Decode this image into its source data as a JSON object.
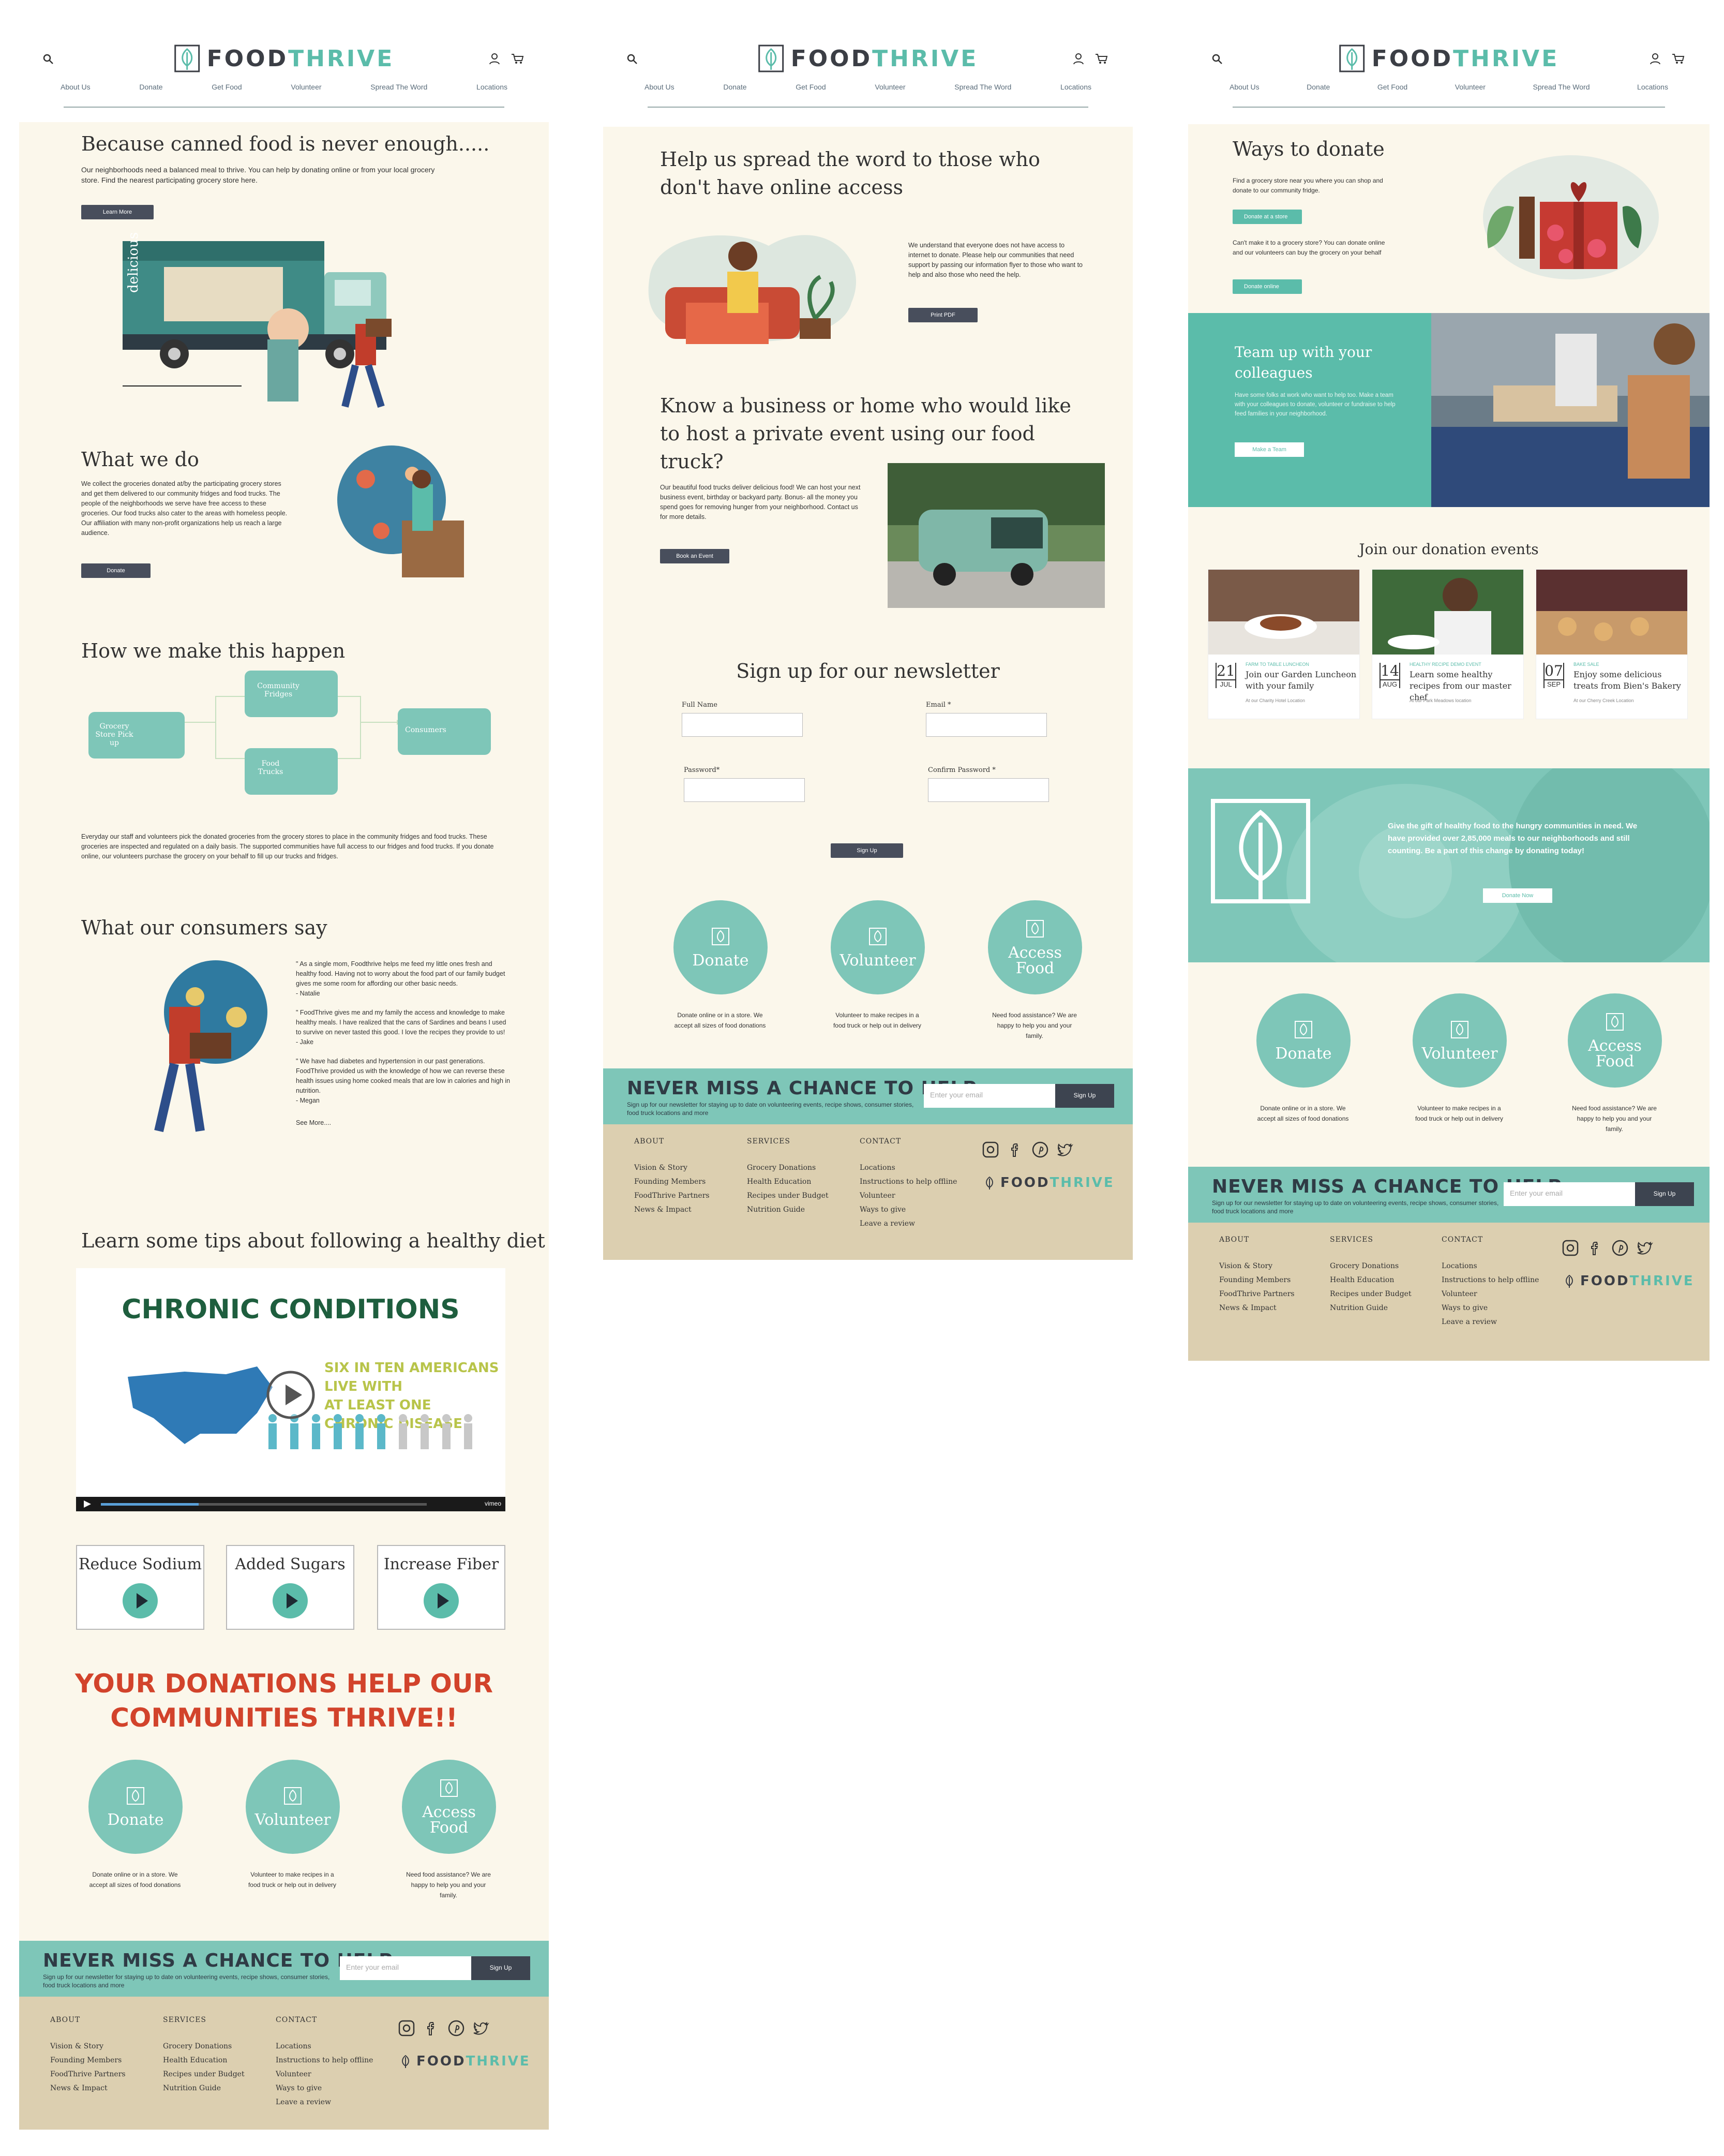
{
  "brand": {
    "name_a": "FOOD",
    "name_b": "THRIVE"
  },
  "nav": [
    "About Us",
    "Donate",
    "Get Food",
    "Volunteer",
    "Spread The Word",
    "Locations"
  ],
  "icons": {
    "search": "search-icon",
    "user": "user-icon",
    "cart": "cart-icon",
    "leaf": "leaf-logo-icon",
    "play": "play-icon"
  },
  "colors": {
    "teal": "#7ec6b8",
    "brand_teal": "#5bbcaa",
    "dark": "#484e5c",
    "cream": "#fbf7eb",
    "footer": "#dccfb0"
  },
  "home": {
    "hero_title": "Because canned food is never enough.....",
    "hero_text": "Our neighborhoods need a balanced meal to thrive. You can help by donating online or from your local grocery store. Find the nearest participating grocery store here.",
    "hero_btn": "Learn More",
    "truck_word": "delicious",
    "what_title": "What we do",
    "what_text": "We collect the  groceries donated at/by the participating grocery stores and get them delivered to our community fridges and food trucks. The people of the neighborhoods we serve have free access to these groceries. Our food trucks also cater to the areas with homeless people. Our affiliation with many non-profit organizations help us reach a large audience.",
    "what_btn": "Donate",
    "how_title": "How we make this happen",
    "flow": [
      "Grocery Store Pick up",
      "Community Fridges",
      "Food Trucks",
      "Consumers"
    ],
    "how_text": "Everyday our staff and volunteers pick the donated groceries from the grocery stores to place in the community fridges and food trucks. These groceries are inspected and regulated on a daily basis. The supported communities have full access to our fridges and food trucks. If you donate online, our volunteers purchase the grocery on your behalf to fill up our trucks and fridges.",
    "say_title": "What our consumers say",
    "quotes": [
      "\" As a single mom, Foodthrive helps me feed my little ones fresh and healthy food. Having not to worry about the food part of our family budget gives me some room for affording our other basic needs.",
      "- Natalie",
      "\" FoodThrive gives me and my family the access and knowledge to make healthy meals. I have realized that the cans of Sardines and beans I used to survive on never tasted this good. I love the recipes they provide to us!",
      "- Jake",
      "\" We have had diabetes and hypertension in our past generations. FoodThrive provided us with the knowledge of how we can reverse these health issues using home cooked meals that are low in calories and high in nutrition.",
      "- Megan"
    ],
    "see_more": "See More....",
    "tips_title": "Learn some tips about following a healthy diet",
    "video_title": "CHRONIC CONDITIONS",
    "video_sub1": "SIX IN TEN AMERICANS LIVE WITH",
    "video_sub2": "AT LEAST ONE CHRONIC DISEASE",
    "video_brand": "vimeo",
    "tips": [
      "Reduce Sodium",
      "Added Sugars",
      "Increase Fiber"
    ],
    "banner1": "YOUR DONATIONS HELP OUR",
    "banner2": "COMMUNITIES THRIVE!!"
  },
  "cta": [
    {
      "label": "Donate",
      "text": "Donate online or in a store. We accept all sizes of food donations"
    },
    {
      "label": "Volunteer",
      "text": "Volunteer to make recipes in a food truck or help out in delivery"
    },
    {
      "label": "Access Food",
      "text": "Need food assistance? We are happy to help you and your family."
    }
  ],
  "newsletter": {
    "title": "NEVER MISS A CHANCE TO HELP",
    "text": "Sign up for our newsletter for staying up to date on volunteering events, recipe shows, consumer stories, food truck locations and more",
    "placeholder": "Enter your email",
    "btn": "Sign Up"
  },
  "footer": {
    "about": {
      "h": "ABOUT",
      "items": [
        "Vision & Story",
        "Founding Members",
        "FoodThrive Partners",
        "News & Impact"
      ]
    },
    "services": {
      "h": "SERVICES",
      "items": [
        "Grocery Donations",
        "Health Education",
        "Recipes under Budget",
        "Nutrition Guide"
      ]
    },
    "contact": {
      "h": "CONTACT",
      "items": [
        "Locations",
        "Instructions to help offline",
        "Volunteer",
        "Ways to give",
        "Leave a review"
      ]
    }
  },
  "spread": {
    "title": "Help us spread the word to those who don't have online access",
    "text": "We understand that everyone does not have access to internet to donate. Please help our communities that need support by passing our information flyer to those who want to help and also those who need the help.",
    "btn": "Print PDF",
    "event_title": "Know a business or home who would like to host a private event using our food truck?",
    "event_text": "Our beautiful food trucks deliver delicious food! We can host your next business event, birthday or backyard party. Bonus- all the money you spend goes for removing hunger from your neighborhood. Contact us for more details.",
    "event_btn": "Book an Event",
    "signup_title": "Sign up for our newsletter",
    "fields": [
      "Full Name",
      "Email *",
      "Password*",
      "Confirm Password *"
    ],
    "signup_btn": "Sign Up"
  },
  "donate": {
    "title": "Ways to donate",
    "text1": "Find a grocery store near you where you can shop and donate to our community fridge.",
    "btn1": "Donate at a store",
    "text2": "Can't make it to a grocery store? You can donate online and our volunteers can buy the grocery on your behalf",
    "btn2": "Donate online",
    "team_title": "Team up with your colleagues",
    "team_text": "Have some folks at work who want to help too. Make a team with your colleagues to donate, volunteer or fundraise to help feed families in your neighborhood.",
    "team_btn": "Make a Team",
    "events_title": "Join our donation events",
    "events": [
      {
        "cat": "FARM TO TABLE LUNCHEON",
        "day": "21",
        "mon": "JUL",
        "title": "Join our Garden Luncheon with your family",
        "loc": "At our Charity Hotel Location"
      },
      {
        "cat": "HEALTHY RECIPE DEMO EVENT",
        "day": "14",
        "mon": "AUG",
        "title": "Learn some healthy recipes from our master chef",
        "loc": "At our Park Meadows location"
      },
      {
        "cat": "BAKE SALE",
        "day": "07",
        "mon": "SEP",
        "title": "Enjoy some delicious treats from Bien's Bakery",
        "loc": "At our Cherry Creek Location"
      }
    ],
    "gift_text": "Give the gift of healthy food to the hungry communities in need. We have provided over 2,85,000 meals to our neighborhoods and still counting. Be a part of this change by donating today!",
    "gift_btn": "Donate Now"
  }
}
